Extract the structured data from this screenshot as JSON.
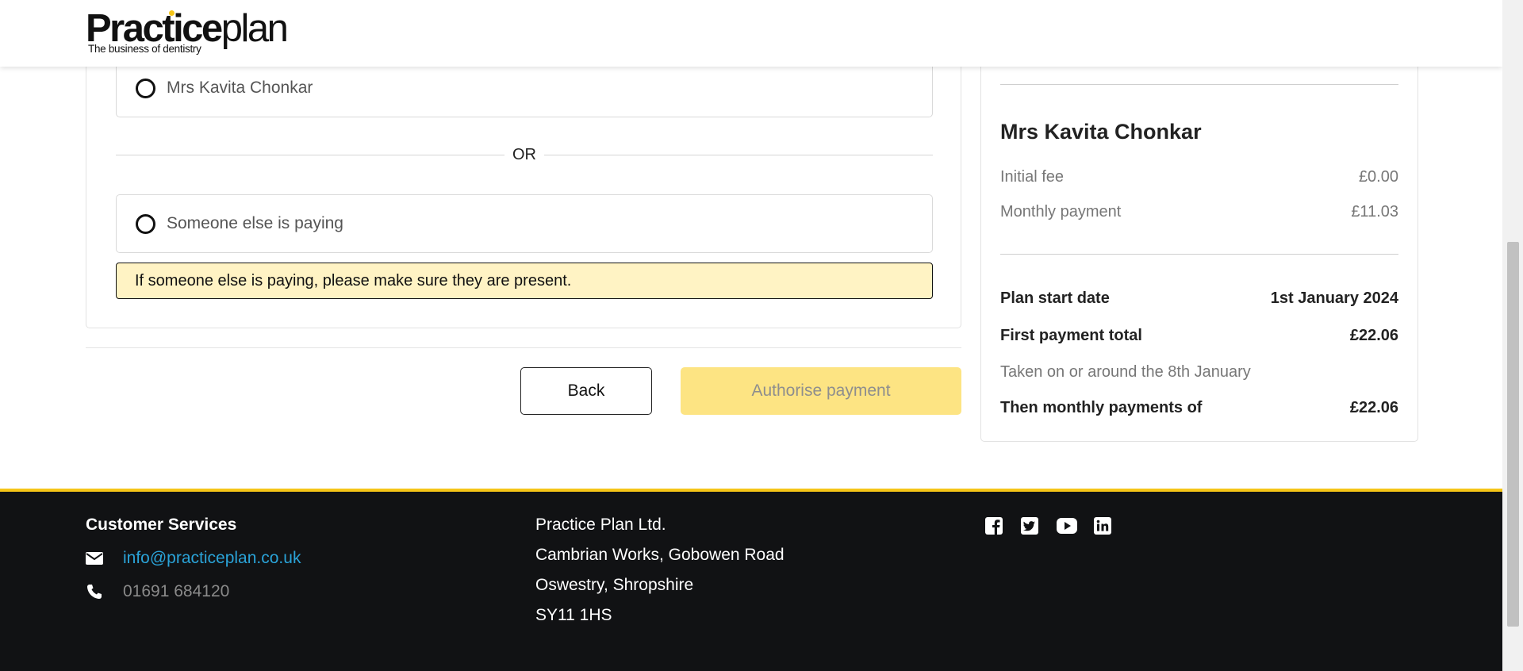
{
  "header": {
    "logo_bold": "Practice",
    "logo_light": "plan",
    "logo_tagline": "The business of dentistry"
  },
  "payer": {
    "option_self": "Mrs Kavita Chonkar",
    "or_label": "OR",
    "option_other": "Someone else is paying",
    "notice": "If someone else is paying, please make sure they are present."
  },
  "actions": {
    "back_label": "Back",
    "authorise_label": "Authorise payment"
  },
  "summary": {
    "customer_name": "Mrs Kavita Chonkar",
    "initial_fee_label": "Initial fee",
    "initial_fee_value": "£0.00",
    "monthly_label": "Monthly payment",
    "monthly_value": "£11.03",
    "start_date_label": "Plan start date",
    "start_date_value": "1st January 2024",
    "first_total_label": "First payment total",
    "first_total_value": "£22.06",
    "taken_note": "Taken on or around the 8th January",
    "then_monthly_label": "Then monthly payments of",
    "then_monthly_value": "£22.06"
  },
  "footer": {
    "customer_services_title": "Customer Services",
    "email": "info@practiceplan.co.uk",
    "phone": "01691 684120",
    "company": "Practice Plan Ltd.",
    "address_line1": "Cambrian Works, Gobowen Road",
    "address_line2": "Oswestry, Shropshire",
    "postcode": "SY11 1HS",
    "social_icons": [
      "facebook-icon",
      "twitter-icon",
      "youtube-icon",
      "linkedin-icon"
    ]
  },
  "colors": {
    "brand_yellow": "#f5c518",
    "button_disabled_yellow": "#fde483",
    "notice_bg": "#fff3c4",
    "footer_bg": "#111214",
    "link_blue": "#2aa3d8"
  }
}
